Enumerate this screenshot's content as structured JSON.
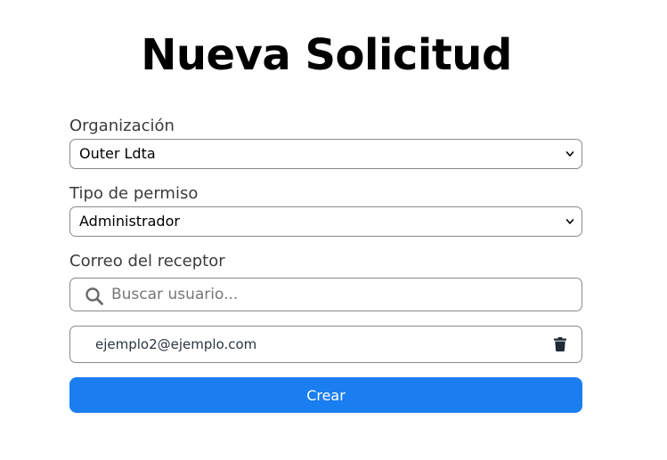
{
  "page": {
    "title": "Nueva Solicitud"
  },
  "form": {
    "organization": {
      "label": "Organización",
      "selected": "Outer Ldta"
    },
    "permission": {
      "label": "Tipo de permiso",
      "selected": "Administrador"
    },
    "recipient": {
      "label": "Correo del receptor",
      "search_placeholder": "Buscar usuario...",
      "search_value": "",
      "emails": [
        "ejemplo2@ejemplo.com"
      ]
    },
    "submit_label": "Crear"
  },
  "icons": {
    "search": "search-icon",
    "delete": "trash-icon",
    "dropdown": "chevron-down-icon"
  },
  "colors": {
    "primary_button": "#1a7ef0",
    "border": "#8a8a8a",
    "label_text": "#3b3b3b",
    "email_text": "#2b3640"
  }
}
